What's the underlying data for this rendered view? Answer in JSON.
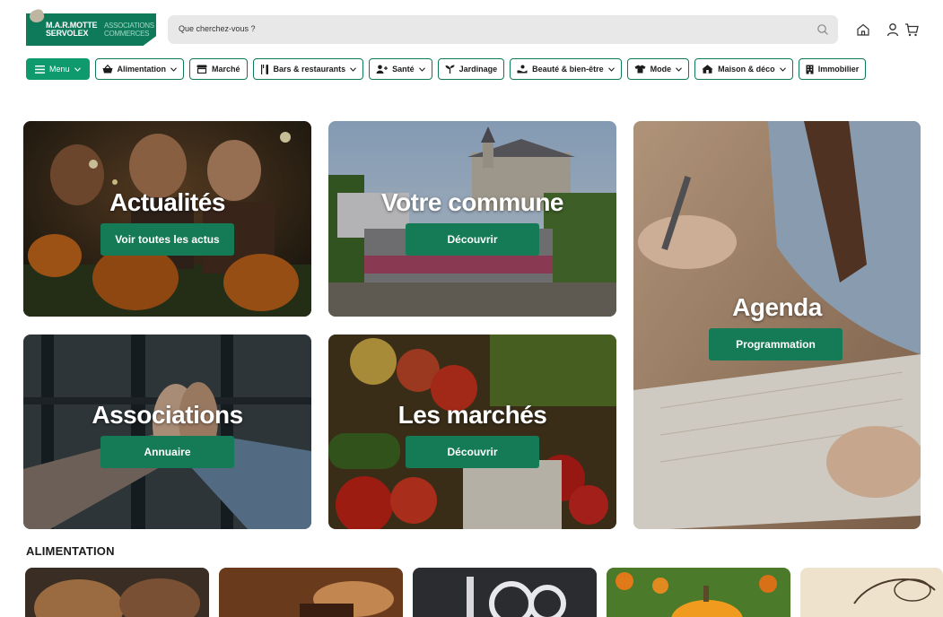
{
  "header": {
    "logo_main": "M.A.R.MOTTE SERVOLEX",
    "logo_sub": "ASSOCIATIONS COMMERCES",
    "search_placeholder": "Que cherchez-vous ?"
  },
  "nav": {
    "items": [
      {
        "label": "Menu",
        "icon": "hamburger-icon"
      },
      {
        "label": "Alimentation",
        "icon": "basket-icon"
      },
      {
        "label": "Marché",
        "icon": "market-stall-icon"
      },
      {
        "label": "Bars & restaurants",
        "icon": "cutlery-icon"
      },
      {
        "label": "Santé",
        "icon": "user-plus-icon"
      },
      {
        "label": "Jardinage",
        "icon": "sprout-icon"
      },
      {
        "label": "Beauté & bien-être",
        "icon": "hand-icon"
      },
      {
        "label": "Mode",
        "icon": "tshirt-icon"
      },
      {
        "label": "Maison & déco",
        "icon": "house-icon"
      },
      {
        "label": "Immobilier",
        "icon": "building-icon"
      }
    ]
  },
  "tiles": {
    "actualites": {
      "title": "Actualités",
      "cta": "Voir toutes les actus"
    },
    "commune": {
      "title": "Votre commune",
      "cta": "Découvrir"
    },
    "agenda": {
      "title": "Agenda",
      "cta": "Programmation"
    },
    "associations": {
      "title": "Associations",
      "cta": "Annuaire"
    },
    "marches": {
      "title": "Les marchés",
      "cta": "Découvrir"
    }
  },
  "sections": {
    "alimentation": "ALIMENTATION"
  },
  "colors": {
    "brand": "#0f7a5a",
    "menu_bg": "#0f9a6e",
    "cta": "#157a56"
  }
}
